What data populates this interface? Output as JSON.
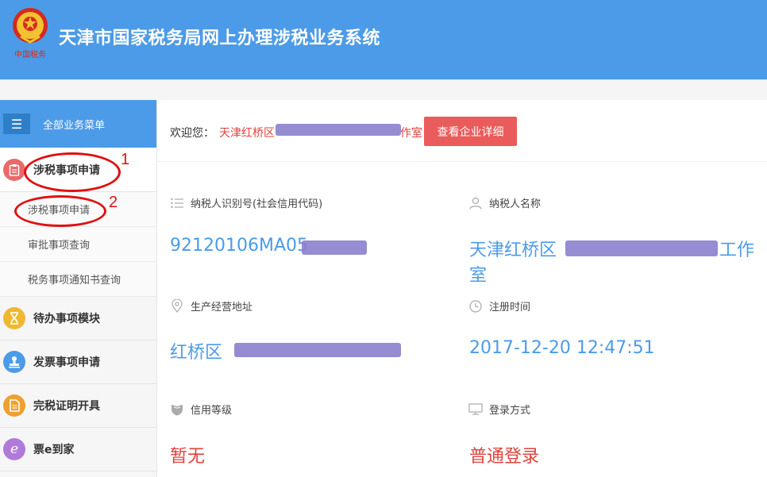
{
  "header": {
    "title": "天津市国家税务局网上办理涉税业务系统",
    "logo_text": "中国税务"
  },
  "sidebar": {
    "menu_label": "全部业务菜单",
    "groups": [
      {
        "label": "涉税事项申请",
        "icon": "clipboard-icon",
        "color": "#e86a6a"
      },
      {
        "label": "待办事项模块",
        "icon": "hourglass-icon",
        "color": "#f0b830"
      },
      {
        "label": "发票事项申请",
        "icon": "stamp-icon",
        "color": "#4c9be8"
      },
      {
        "label": "完税证明开具",
        "icon": "document-icon",
        "color": "#f0a030"
      },
      {
        "label": "票e到家",
        "icon": "e-icon",
        "color": "#b07ad8"
      }
    ],
    "subitems": [
      "涉税事项申请",
      "审批事项查询",
      "税务事项通知书查询"
    ]
  },
  "annotations": [
    "1",
    "2"
  ],
  "welcome": {
    "label": "欢迎您：",
    "company": "天津红桥区",
    "company_tail": "作室",
    "detail_button": "查看企业详细"
  },
  "info": {
    "taxpayer_id_label": "纳税人识别号(社会信用代码)",
    "taxpayer_id_value": "92120106MA05",
    "taxpayer_name_label": "纳税人名称",
    "taxpayer_name_value_1": "天津红桥区",
    "taxpayer_name_value_2": "工作",
    "taxpayer_name_value_3": "室",
    "address_label": "生产经营地址",
    "address_value": "红桥区",
    "register_time_label": "注册时间",
    "register_time_value": "2017-12-20 12:47:51",
    "credit_level_label": "信用等级",
    "credit_level_value": "暂无",
    "login_method_label": "登录方式",
    "login_method_value": "普通登录"
  }
}
